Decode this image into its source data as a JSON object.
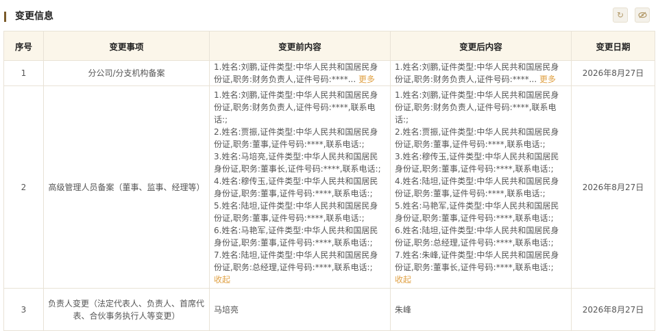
{
  "section": {
    "title": "变更信息"
  },
  "table": {
    "headers": [
      "序号",
      "变更事项",
      "变更前内容",
      "变更后内容",
      "变更日期"
    ],
    "rows": [
      {
        "index": "1",
        "item": "分公司/分支机构备案",
        "before_lines": [
          "1.姓名:刘鹏,证件类型:中华人民共和国居民身",
          "份证,职务:财务负责人,证件号码:****..."
        ],
        "before_link": "更多",
        "after_lines": [
          "1.姓名:刘鹏,证件类型:中华人民共和国居民身",
          "份证,职务:财务负责人,证件号码:****..."
        ],
        "after_link": "更多",
        "date": "2026年8月27日"
      },
      {
        "index": "2",
        "item": "高级管理人员备案（董事、监事、经理等）",
        "before_lines": [
          "1.姓名:刘鹏,证件类型:中华人民共和国居民身",
          "份证,职务:财务负责人,证件号码:****,联系电",
          "话:;",
          "2.姓名:贾振,证件类型:中华人民共和国居民身",
          "份证,职务:董事,证件号码:****,联系电话:;",
          "3.姓名:马培亮,证件类型:中华人民共和国居民",
          "身份证,职务:董事长,证件号码:****,联系电话:;",
          "4.姓名:穆传玉,证件类型:中华人民共和国居民",
          "身份证,职务:董事,证件号码:****,联系电话:;",
          "5.姓名:陆坦,证件类型:中华人民共和国居民身",
          "份证,职务:董事,证件号码:****,联系电话:;",
          "6.姓名:马艳军,证件类型:中华人民共和国居民",
          "身份证,职务:董事,证件号码:****,联系电话:;",
          "7.姓名:陆坦,证件类型:中华人民共和国居民身",
          "份证,职务:总经理,证件号码:****,联系电话:;"
        ],
        "before_link": "收起",
        "after_lines": [
          "1.姓名:刘鹏,证件类型:中华人民共和国居民身",
          "份证,职务:财务负责人,证件号码:****,联系电",
          "话:;",
          "2.姓名:贾振,证件类型:中华人民共和国居民身",
          "份证,职务:董事,证件号码:****,联系电话:;",
          "3.姓名:穆传玉,证件类型:中华人民共和国居民",
          "身份证,职务:董事,证件号码:****,联系电话:;",
          "4.姓名:陆坦,证件类型:中华人民共和国居民身",
          "份证,职务:董事,证件号码:****,联系电话:;",
          "5.姓名:马艳军,证件类型:中华人民共和国居民",
          "身份证,职务:董事,证件号码:****,联系电话:;",
          "6.姓名:陆坦,证件类型:中华人民共和国居民身",
          "份证,职务:总经理,证件号码:****,联系电话:;",
          "7.姓名:朱峰,证件类型:中华人民共和国居民身",
          "份证,职务:董事长,证件号码:****,联系电话:;"
        ],
        "after_link": "收起",
        "date": "2026年8月27日"
      },
      {
        "index": "3",
        "item_lines": [
          "负责人变更（法定代表人、负责人、首席代",
          "表、合伙事务执行人等变更）"
        ],
        "before_text": "马培亮",
        "after_text": "朱峰",
        "date": "2026年8月27日"
      }
    ]
  }
}
